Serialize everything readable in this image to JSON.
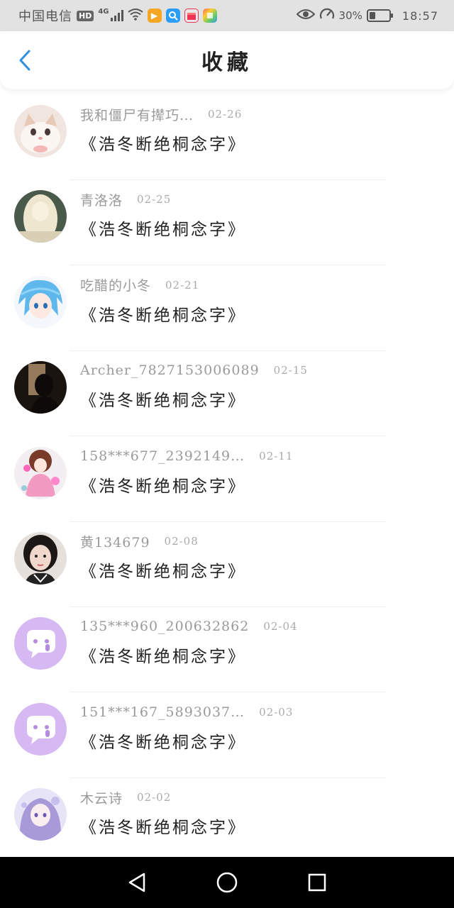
{
  "status_bar": {
    "carrier": "中国电信",
    "hd": "HD",
    "network": "4G",
    "battery_percent": "30%",
    "battery_level": 0.3,
    "time": "18:57"
  },
  "header": {
    "title": "收藏",
    "back_icon": "chevron-left-icon"
  },
  "items": [
    {
      "user": "我和僵尸有撵巧…",
      "date": "02-26",
      "title": "《浩冬断绝桐念字》",
      "avatar": "kitten"
    },
    {
      "user": "青洛洛",
      "date": "02-25",
      "title": "《浩冬断绝桐念字》",
      "avatar": "pale-girl"
    },
    {
      "user": "吃醋的小冬",
      "date": "02-21",
      "title": "《浩冬断绝桐念字》",
      "avatar": "blue-hair-anime"
    },
    {
      "user": "Archer_7827153006089",
      "date": "02-15",
      "title": "《浩冬断绝桐念字》",
      "avatar": "dark-silhouette"
    },
    {
      "user": "158***677_2392149…",
      "date": "02-11",
      "title": "《浩冬断绝桐念字》",
      "avatar": "pink-anime"
    },
    {
      "user": "黄134679",
      "date": "02-08",
      "title": "《浩冬断绝桐念字》",
      "avatar": "girl-photo"
    },
    {
      "user": "135***960_200632862",
      "date": "02-04",
      "title": "《浩冬断绝桐念字》",
      "avatar": "default-chat"
    },
    {
      "user": "151***167_5893037…",
      "date": "02-03",
      "title": "《浩冬断绝桐念字》",
      "avatar": "default-chat"
    },
    {
      "user": "木云诗",
      "date": "02-02",
      "title": "《浩冬断绝桐念字》",
      "avatar": "purple-anime"
    }
  ],
  "nav_bar": {
    "back": "triangle-back-icon",
    "home": "circle-home-icon",
    "recents": "square-recents-icon"
  },
  "colors": {
    "accent": "#2f8fe0",
    "default_avatar": "#d6b8f2"
  }
}
